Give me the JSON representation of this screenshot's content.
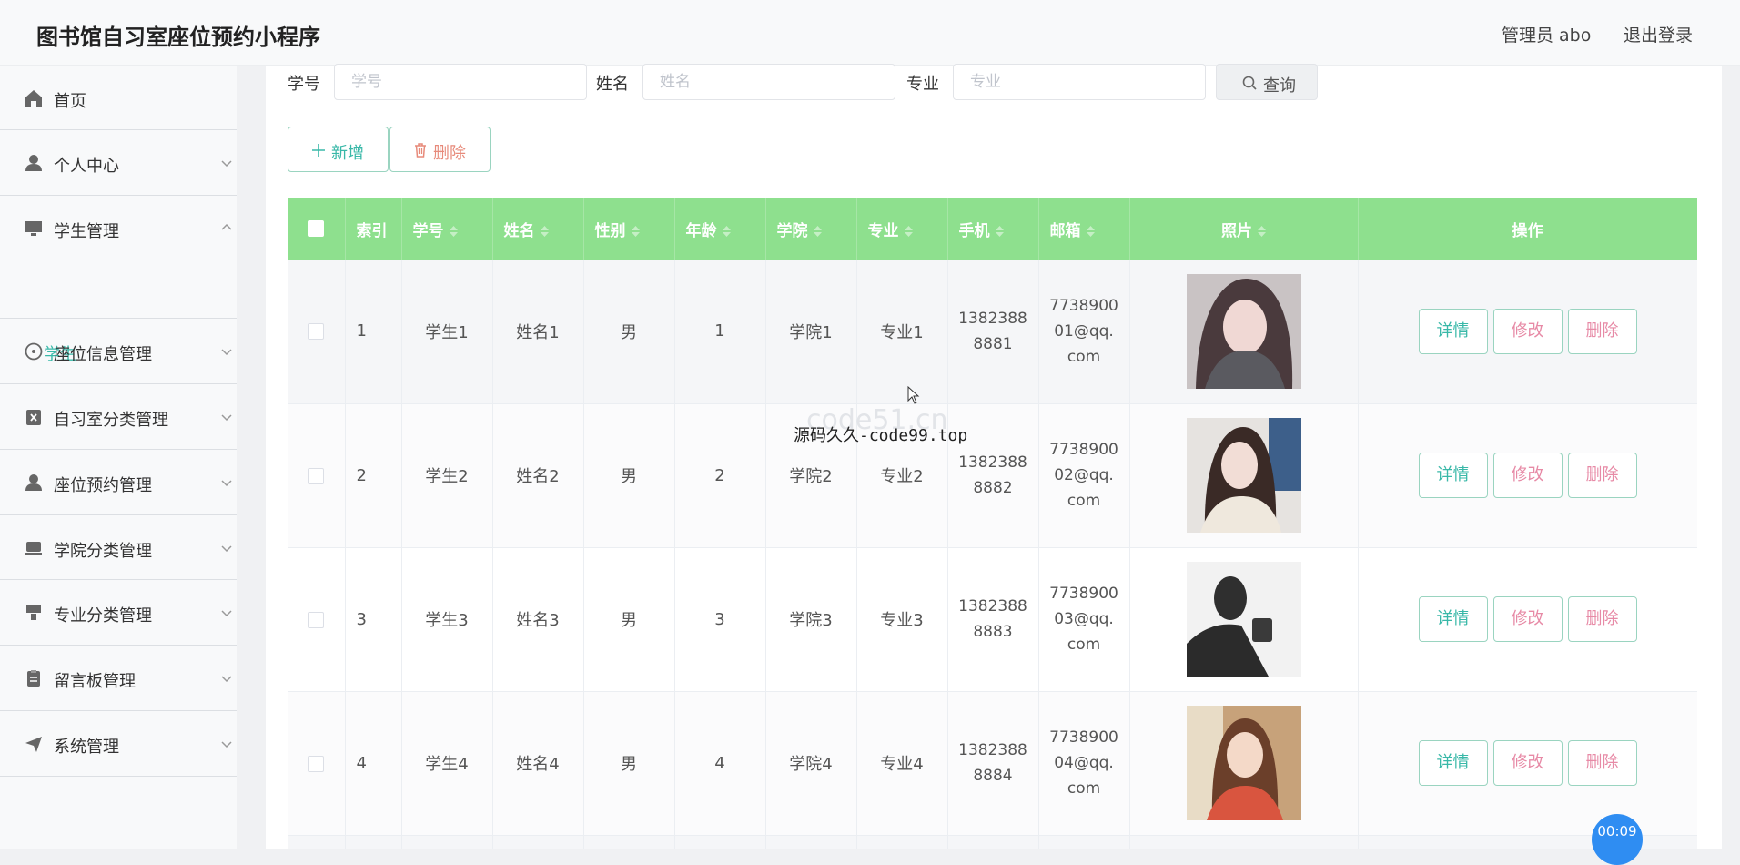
{
  "header": {
    "title": "图书馆自习室座位预约小程序",
    "admin": "管理员 abo",
    "logout": "退出登录"
  },
  "sidebar": {
    "items": [
      {
        "label": "首页",
        "icon": "home-icon"
      },
      {
        "label": "个人中心",
        "icon": "user-icon"
      },
      {
        "label": "学生管理",
        "icon": "monitor-icon"
      },
      {
        "label": "座位信息管理",
        "icon": "compass-icon"
      },
      {
        "label": "自习室分类管理",
        "icon": "clipboard-x-icon"
      },
      {
        "label": "座位预约管理",
        "icon": "user-icon"
      },
      {
        "label": "学院分类管理",
        "icon": "monitor-icon"
      },
      {
        "label": "专业分类管理",
        "icon": "cabinet-icon"
      },
      {
        "label": "留言板管理",
        "icon": "clipboard-icon"
      },
      {
        "label": "系统管理",
        "icon": "send-icon"
      }
    ],
    "submenu": {
      "label": "学生"
    }
  },
  "search": {
    "xuehao": {
      "label": "学号",
      "placeholder": "学号"
    },
    "xingming": {
      "label": "姓名",
      "placeholder": "姓名"
    },
    "zhuanye": {
      "label": "专业",
      "placeholder": "专业"
    },
    "query_label": "查询"
  },
  "actions": {
    "add_label": "新增",
    "delete_label": "删除"
  },
  "table": {
    "headers": [
      "索引",
      "学号",
      "姓名",
      "性别",
      "年龄",
      "学院",
      "专业",
      "手机",
      "邮箱",
      "照片",
      "操作"
    ],
    "rows": [
      {
        "index": "1",
        "xuehao": "学生1",
        "xingming": "姓名1",
        "xingbie": "男",
        "nianling": "1",
        "xueyuan": "学院1",
        "zhuanye": "专业1",
        "shouji_1": "1382388",
        "shouji_2": "8881",
        "email_1": "7738900",
        "email_2": "01@qq.",
        "email_3": "com"
      },
      {
        "index": "2",
        "xuehao": "学生2",
        "xingming": "姓名2",
        "xingbie": "男",
        "nianling": "2",
        "xueyuan": "学院2",
        "zhuanye": "专业2",
        "shouji_1": "1382388",
        "shouji_2": "8882",
        "email_1": "7738900",
        "email_2": "02@qq.",
        "email_3": "com"
      },
      {
        "index": "3",
        "xuehao": "学生3",
        "xingming": "姓名3",
        "xingbie": "男",
        "nianling": "3",
        "xueyuan": "学院3",
        "zhuanye": "专业3",
        "shouji_1": "1382388",
        "shouji_2": "8883",
        "email_1": "7738900",
        "email_2": "03@qq.",
        "email_3": "com"
      },
      {
        "index": "4",
        "xuehao": "学生4",
        "xingming": "姓名4",
        "xingbie": "男",
        "nianling": "4",
        "xueyuan": "学院4",
        "zhuanye": "专业4",
        "shouji_1": "1382388",
        "shouji_2": "8884",
        "email_1": "7738900",
        "email_2": "04@qq.",
        "email_3": "com"
      }
    ],
    "ops": {
      "detail": "详情",
      "edit": "修改",
      "delete": "删除"
    }
  },
  "watermark": {
    "faint": "code51.cn",
    "text": "源码久久-code99.top"
  },
  "timer": "00:09",
  "colors": {
    "header_bg": "#8ee08e",
    "accent": "#39b8a8",
    "danger": "#e78aa6",
    "timer": "#2f8df2"
  }
}
